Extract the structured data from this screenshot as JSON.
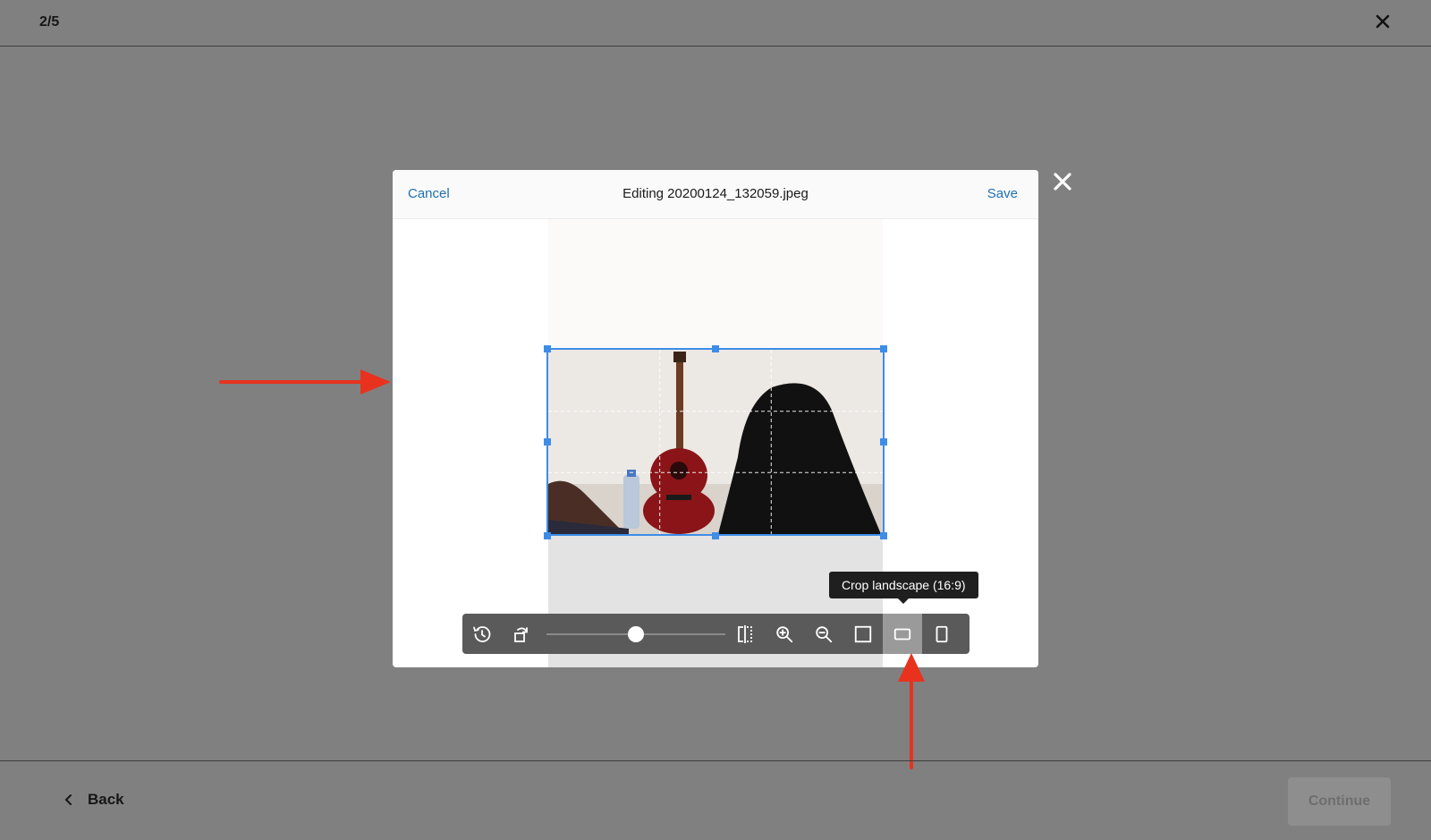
{
  "topbar": {
    "step": "2/5",
    "close_icon": "close-icon"
  },
  "modal": {
    "cancel_label": "Cancel",
    "title": "Editing 20200124_132059.jpeg",
    "save_label": "Save",
    "close_icon": "close-icon"
  },
  "editor": {
    "crop_aspect": "16:9",
    "zoom_level_fraction": 0.5,
    "tooltip": "Crop landscape (16:9)",
    "tools": [
      {
        "name": "reset",
        "icon": "history-icon"
      },
      {
        "name": "rotate",
        "icon": "rotate-icon"
      },
      {
        "name": "flip",
        "icon": "flip-horizontal-icon"
      },
      {
        "name": "zoom-in",
        "icon": "zoom-in-icon"
      },
      {
        "name": "zoom-out",
        "icon": "zoom-out-icon"
      },
      {
        "name": "crop-square",
        "icon": "crop-square-icon"
      },
      {
        "name": "crop-landscape",
        "icon": "crop-landscape-icon",
        "active": true
      },
      {
        "name": "crop-portrait",
        "icon": "crop-portrait-icon"
      }
    ]
  },
  "footer": {
    "back_label": "Back",
    "continue_label": "Continue"
  },
  "colors": {
    "overlay": "#808080",
    "accent_link": "#1f6fb2",
    "crop_border": "#3d8de8",
    "annotation_arrow": "#e8321e"
  }
}
